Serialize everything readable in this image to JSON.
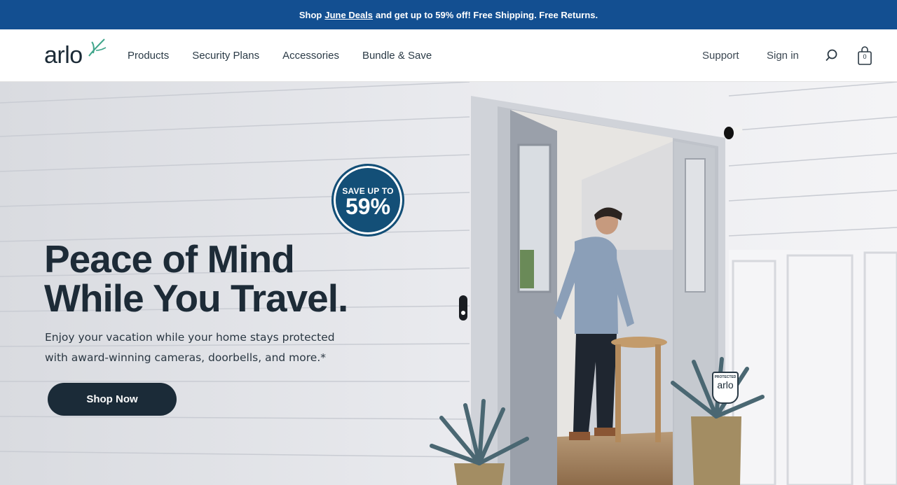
{
  "promo": {
    "prefix": "Shop",
    "link": "June Deals",
    "suffix": "and get up to 59% off! Free Shipping. Free Returns."
  },
  "header": {
    "logo_text": "arlo",
    "nav": [
      "Products",
      "Security Plans",
      "Accessories",
      "Bundle & Save"
    ],
    "support": "Support",
    "sign_in": "Sign in",
    "cart_count": "0"
  },
  "hero": {
    "badge_top": "SAVE UP TO",
    "badge_value": "59%",
    "headline_line1": "Peace of Mind",
    "headline_line2": "While You Travel.",
    "subtext": "Enjoy your vacation while your home stays protected with award-winning cameras, doorbells, and more.*",
    "cta": "Shop Now",
    "yard_sign_label": "PROTECTED",
    "yard_sign_brand": "arlo"
  },
  "colors": {
    "promo_bg": "#134f91",
    "badge_bg": "#134f77",
    "cta_bg": "#1b2b38",
    "logo_accent": "#3fa58a"
  }
}
